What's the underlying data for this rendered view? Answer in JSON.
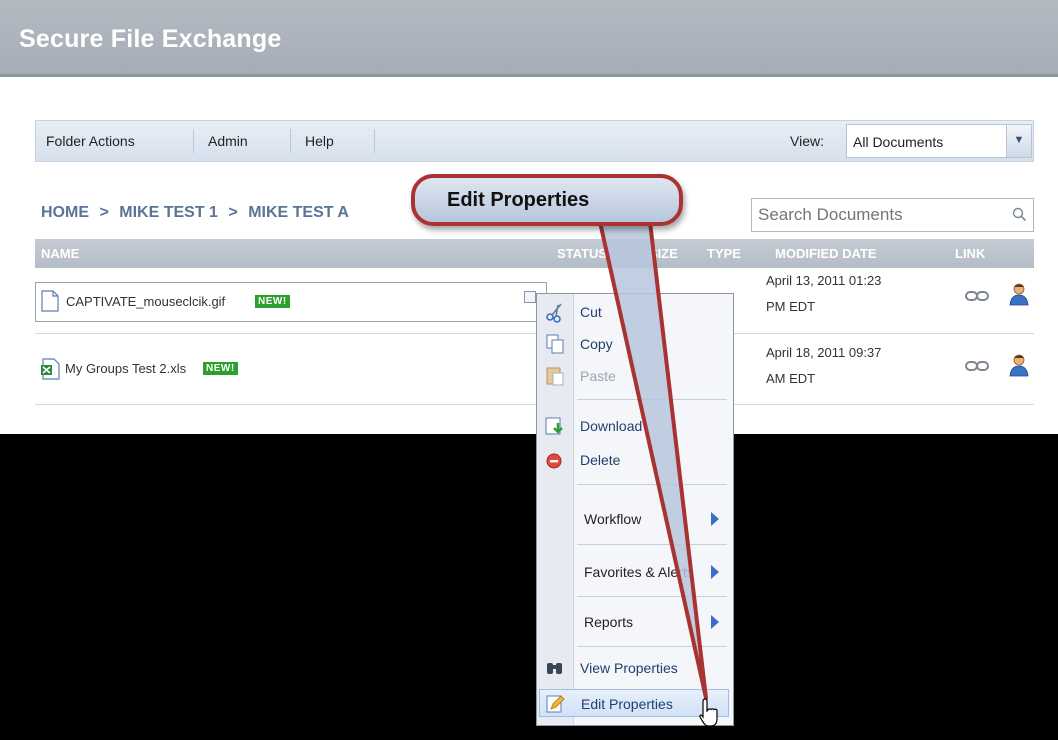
{
  "app": {
    "title": "Secure File Exchange"
  },
  "toolbar": {
    "folder_actions": "Folder Actions",
    "admin": "Admin",
    "help": "Help",
    "view_label": "View:",
    "view_value": "All Documents"
  },
  "breadcrumb": {
    "items": [
      "HOME",
      ">",
      "MIKE TEST 1",
      ">",
      "MIKE TEST A"
    ]
  },
  "search": {
    "placeholder": "Search Documents"
  },
  "columns": {
    "name": "NAME",
    "status": "STATUS",
    "size": "SIZE",
    "type": "TYPE",
    "modified": "MODIFIED DATE",
    "link": "LINK"
  },
  "rows": [
    {
      "name": "CAPTIVATE_mouseclcik.gif",
      "badge": "NEW!",
      "date_line1": "April 13, 2011 01:23",
      "date_line2": "PM EDT"
    },
    {
      "name": "My Groups Test 2.xls",
      "badge": "NEW!",
      "date_line1": "April 18, 2011 09:37",
      "date_line2": "AM EDT"
    }
  ],
  "context_menu": {
    "cut": "Cut",
    "copy": "Copy",
    "paste": "Paste",
    "download": "Download",
    "delete": "Delete",
    "workflow": "Workflow",
    "favorites": "Favorites & Alerts",
    "reports": "Reports",
    "view_properties": "View Properties",
    "edit_properties": "Edit Properties"
  },
  "callout": {
    "text": "Edit Properties"
  },
  "colors": {
    "header_bg": "#a7adb6",
    "accent": "#a93232",
    "link": "#22406e",
    "badge": "#2c9f2c"
  }
}
